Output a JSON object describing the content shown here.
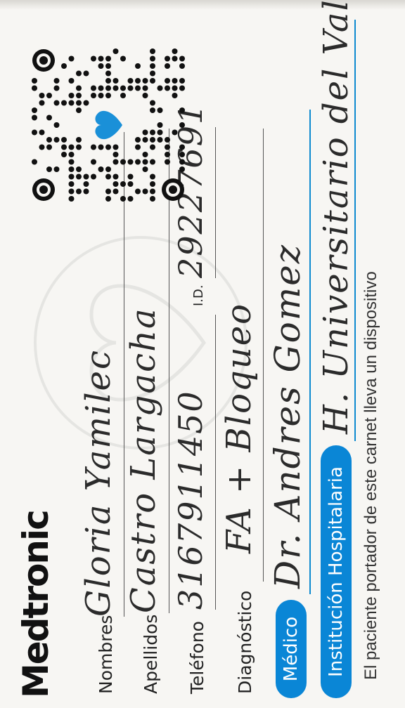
{
  "brand": "Medtronic",
  "fields": {
    "nombres": {
      "label": "Nombres",
      "value": "Gloria Yamilec"
    },
    "apellidos": {
      "label": "Apellidos",
      "value": "Castro Largacha"
    },
    "telefono": {
      "label": "Teléfono",
      "value": "3167911450"
    },
    "id": {
      "label": "I.D.",
      "value": "29227691"
    },
    "diagnostico": {
      "label": "Diagnóstico",
      "value": "FA + Bloqueo"
    },
    "medico": {
      "label": "Médico",
      "value": "Dr. Andres Gomez"
    },
    "institucion": {
      "label": "Institución Hospitalaria",
      "value": "H. Universitario del Valle"
    }
  },
  "footer": "El paciente portador de este carnet lleva un dispositivo",
  "colors": {
    "accent": "#0a86d6",
    "heart": "#1a90d8"
  },
  "qr_icon": "qr-code-with-heart-icon"
}
